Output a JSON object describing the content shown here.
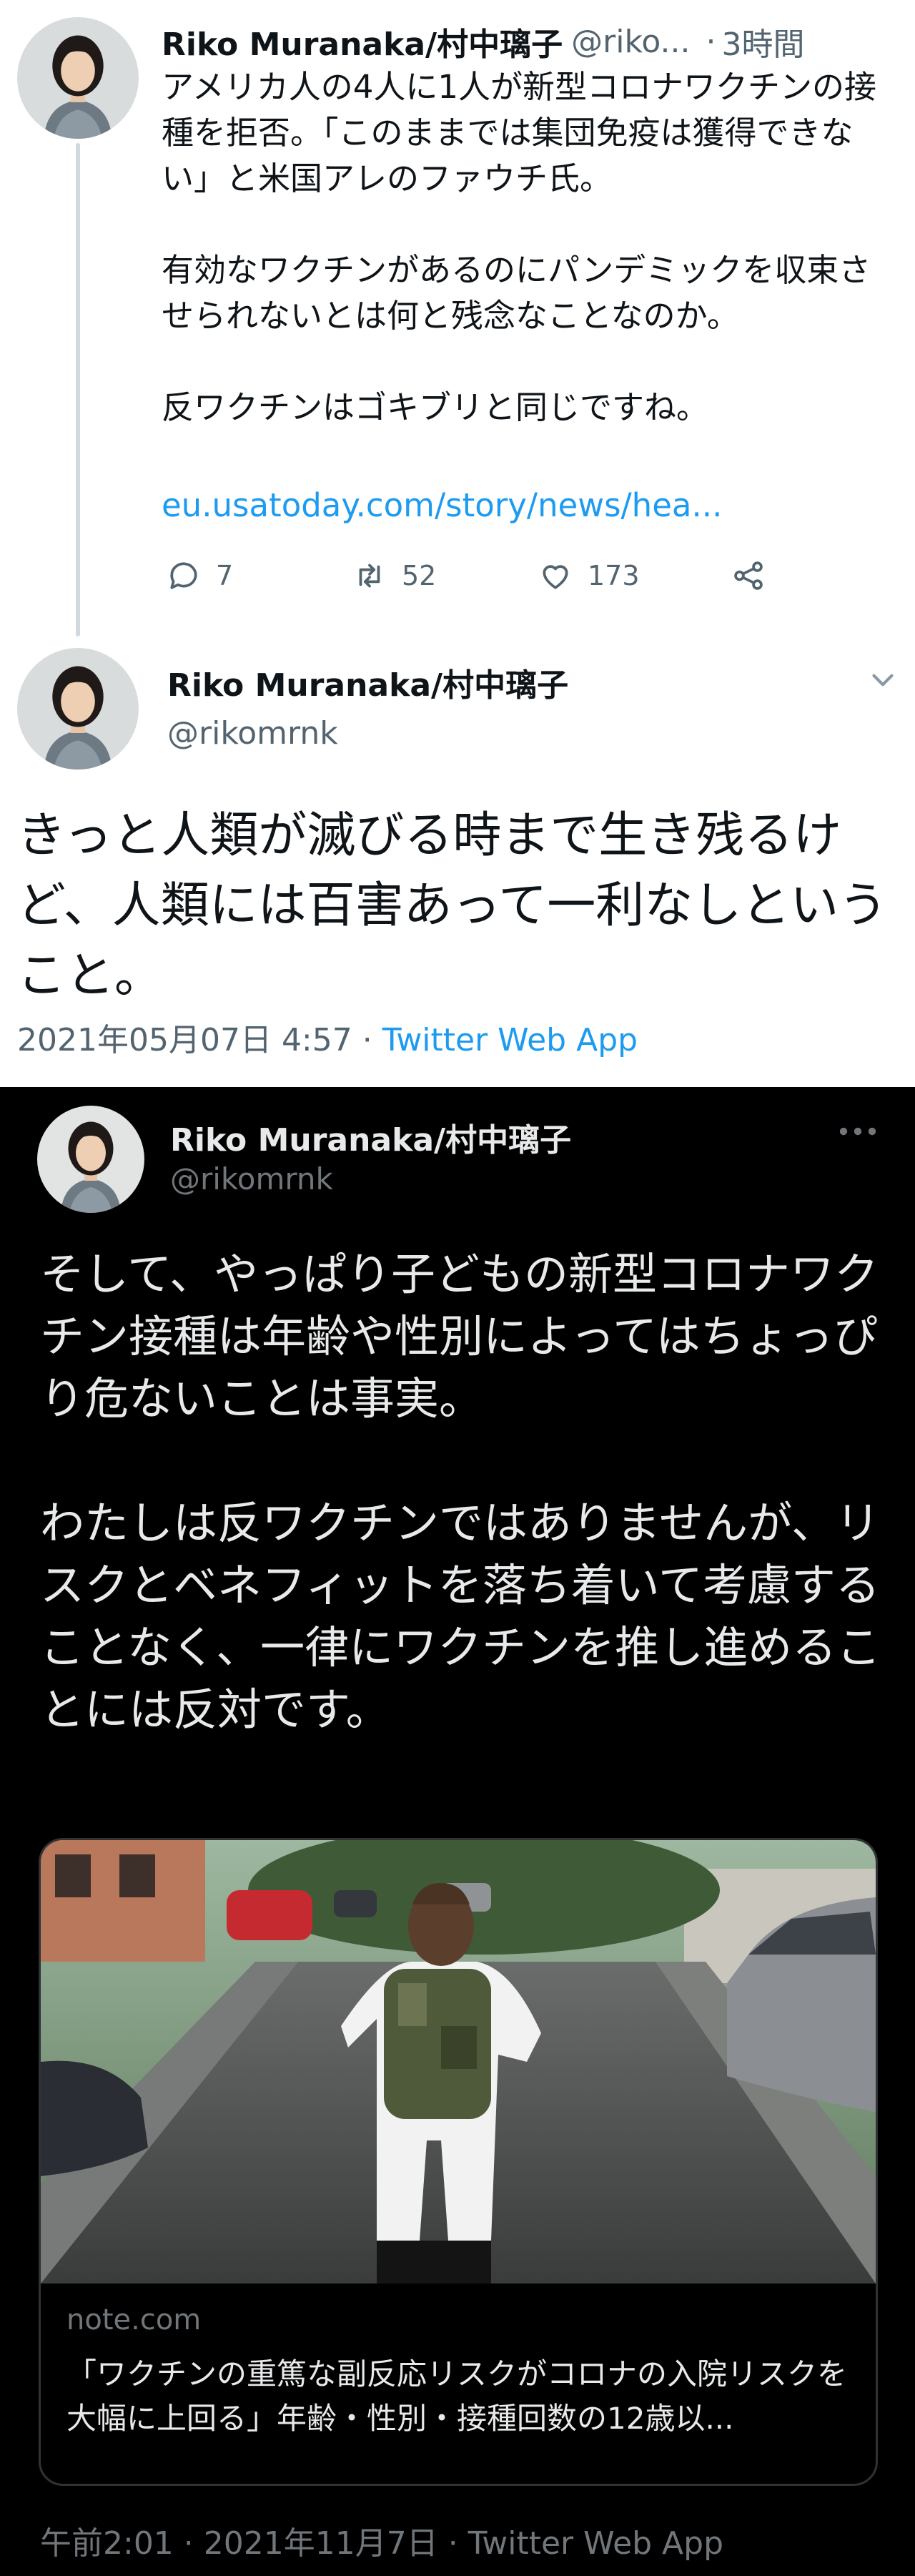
{
  "tweet1": {
    "name": "Riko Muranaka/村中璃子",
    "handle": "@riko...",
    "dot": "·",
    "time": "3時間",
    "para1": "アメリカ人の4人に1人が新型コロナワクチンの接種を拒否。「このままでは集団免疫は獲得できない」と米国アレのファウチ氏。",
    "para2": "有効なワクチンがあるのにパンデミックを収束させられないとは何と残念なことなのか。",
    "para3": "反ワクチンはゴキブリと同じですね。",
    "link": "eu.usatoday.com/story/news/hea...",
    "replies": "7",
    "retweets": "52",
    "likes": "173"
  },
  "tweet2": {
    "name": "Riko Muranaka/村中璃子",
    "handle": "@rikomrnk",
    "text": "きっと人類が滅びる時まで生き残るけど、人類には百害あって一利なしということ。",
    "meta_date": "2021年05月07日 4:57 · ",
    "meta_app": "Twitter Web App"
  },
  "tweet3": {
    "name": "Riko Muranaka/村中璃子",
    "handle": "@rikomrnk",
    "para1": "そして、やっぱり子どもの新型コロナワクチン接種は年齢や性別によってはちょっぴり危ないことは事実。",
    "para2": "わたしは反ワクチンではありませんが、リスクとベネフィットを落ち着いて考慮することなく、一律にワクチンを推し進めることには反対です。",
    "card_domain": "note.com",
    "card_title": "「ワクチンの重篤な副反応リスクがコロナの入院リスクを大幅に上回る」年齢・性別・接種回数の12歳以...",
    "meta": "午前2:01 · 2021年11月7日 · Twitter Web App"
  },
  "icons": [
    "reply-icon",
    "retweet-icon",
    "like-icon",
    "share-icon",
    "chevron-down-icon",
    "more-icon"
  ],
  "colors": {
    "link_blue": "#1d9bf0",
    "gray_light": "#536471",
    "gray_dark": "#71767b",
    "dark_bg": "#000000"
  }
}
